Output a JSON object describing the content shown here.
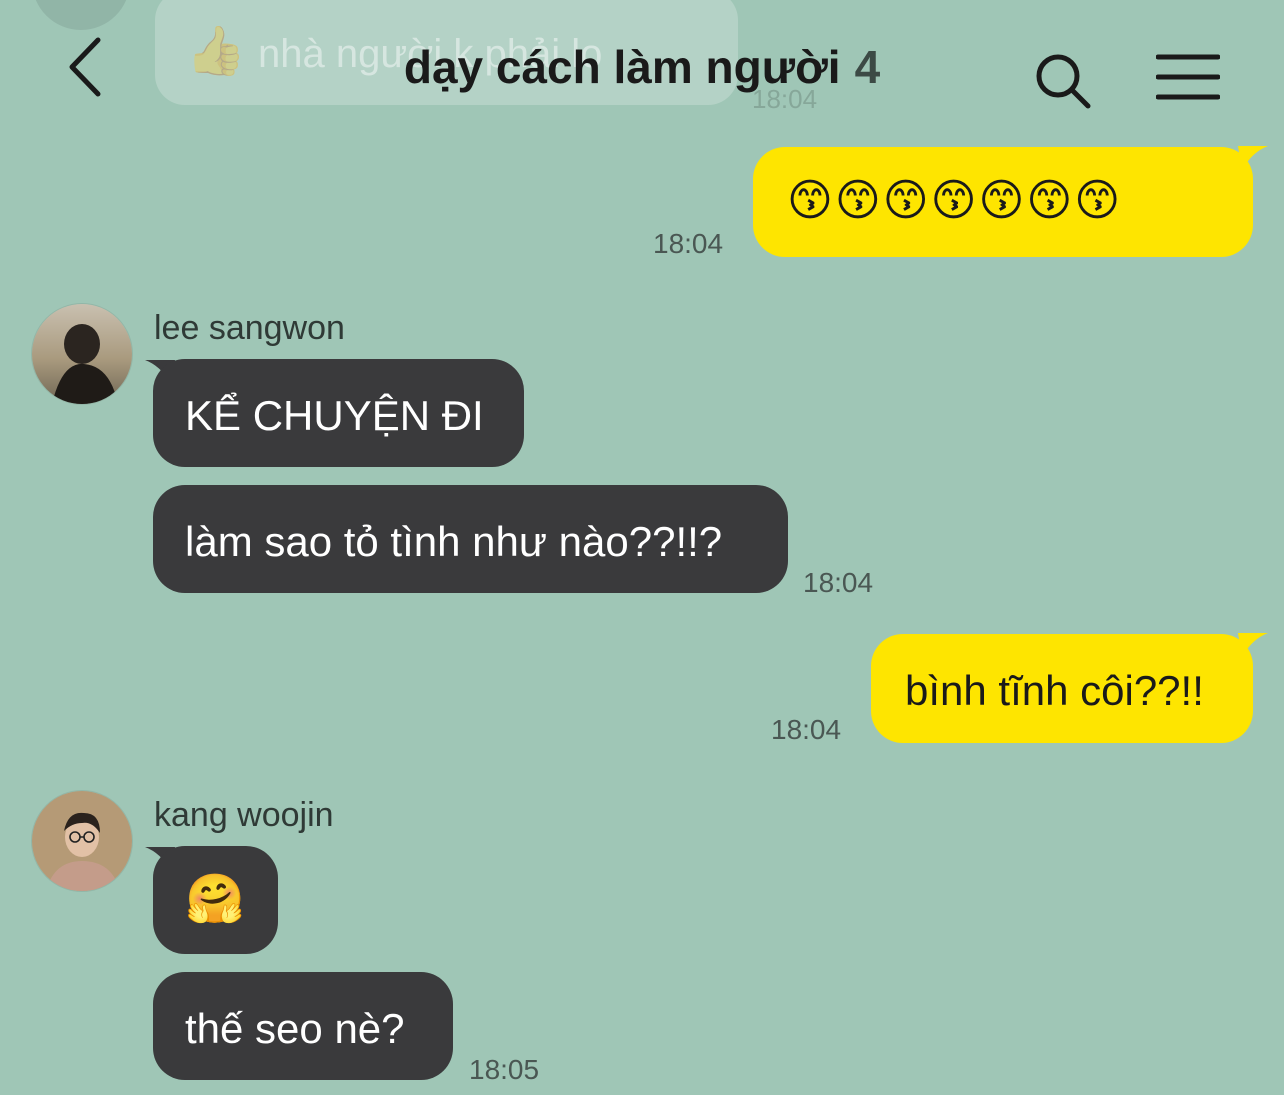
{
  "header": {
    "title": "dạy cách làm người",
    "member_count": "4"
  },
  "background_message": {
    "text": "nhà người k phải lo",
    "time": "18:04"
  },
  "messages": {
    "m1": {
      "text": "😙😙😙😙😙😙😙",
      "time": "18:04"
    },
    "m2": {
      "sender": "lee sangwon",
      "text": "KỂ CHUYỆN ĐI"
    },
    "m3": {
      "text": "làm sao tỏ tình như nào??!!?",
      "time": "18:04"
    },
    "m4": {
      "text": "bình tĩnh côi??!!",
      "time": "18:04"
    },
    "m5": {
      "sender": "kang woojin",
      "text": "🤗"
    },
    "m6": {
      "text": "thế seo nè?",
      "time": "18:05"
    }
  },
  "colors": {
    "background": "#9fc6b6",
    "my_bubble": "#fee500",
    "other_bubble": "#3a3a3c"
  },
  "icons": {
    "back": "chevron-left-icon",
    "search": "search-icon",
    "menu": "hamburger-menu-icon",
    "thumbs_up": "thumbs-up-icon"
  }
}
